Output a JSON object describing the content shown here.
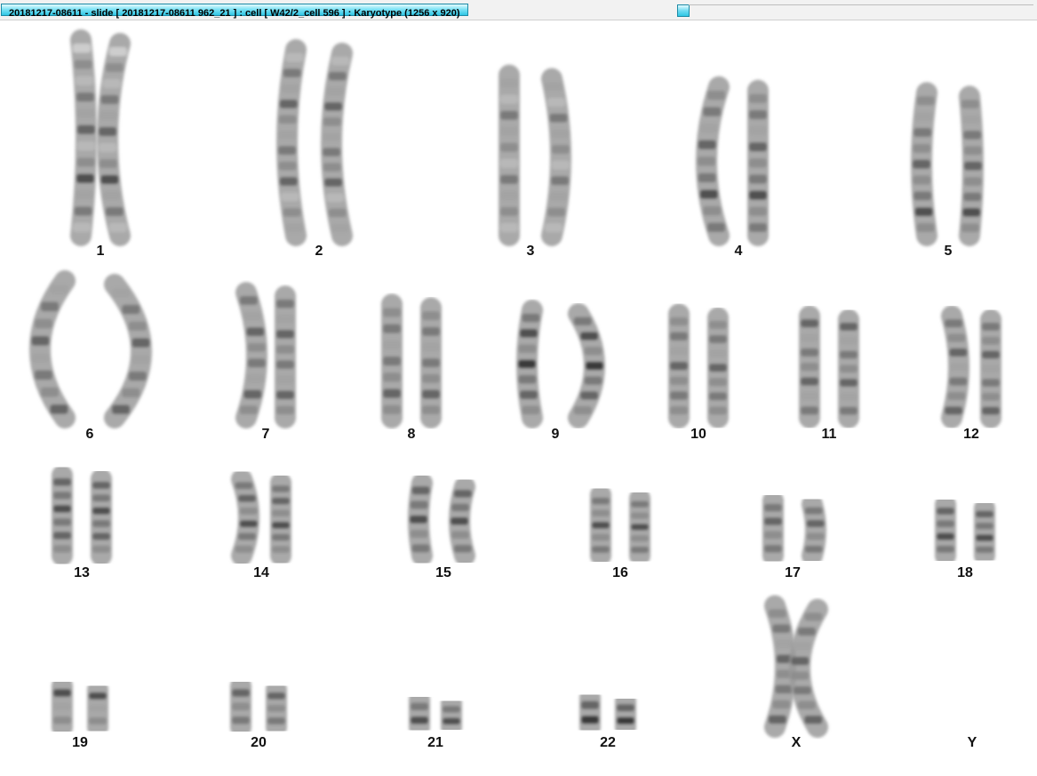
{
  "window": {
    "title": "20181217-08611 - slide [ 20181217-08611 962_21 ] : cell [ W42/2_cell 596 ] : Karyotype  (1256 x 920)"
  },
  "karyotype": {
    "chromosomes": [
      {
        "label": "1",
        "length": 1.0,
        "pattern": [
          0.2,
          0.5,
          0.3,
          0.6,
          0.4,
          0.7,
          0.3,
          0.5,
          0.8,
          0.4,
          0.6,
          0.3
        ]
      },
      {
        "label": "2",
        "length": 0.95,
        "pattern": [
          0.3,
          0.6,
          0.4,
          0.7,
          0.5,
          0.4,
          0.6,
          0.5,
          0.7,
          0.3,
          0.5,
          0.4
        ]
      },
      {
        "label": "3",
        "length": 0.82,
        "pattern": [
          0.4,
          0.3,
          0.6,
          0.4,
          0.5,
          0.3,
          0.6,
          0.4,
          0.5,
          0.3
        ]
      },
      {
        "label": "4",
        "length": 0.76,
        "pattern": [
          0.5,
          0.6,
          0.4,
          0.7,
          0.5,
          0.6,
          0.8,
          0.5,
          0.6
        ]
      },
      {
        "label": "5",
        "length": 0.73,
        "pattern": [
          0.5,
          0.4,
          0.6,
          0.5,
          0.7,
          0.5,
          0.6,
          0.8,
          0.5
        ]
      },
      {
        "label": "6",
        "length": 0.7,
        "pattern": [
          0.4,
          0.6,
          0.5,
          0.7,
          0.4,
          0.6,
          0.5,
          0.7
        ]
      },
      {
        "label": "7",
        "length": 0.64,
        "pattern": [
          0.6,
          0.4,
          0.7,
          0.5,
          0.6,
          0.4,
          0.7,
          0.5
        ]
      },
      {
        "label": "8",
        "length": 0.58,
        "pattern": [
          0.5,
          0.6,
          0.4,
          0.6,
          0.5,
          0.7,
          0.5
        ]
      },
      {
        "label": "9",
        "length": 0.55,
        "pattern": [
          0.6,
          0.8,
          0.5,
          0.9,
          0.6,
          0.7,
          0.5
        ]
      },
      {
        "label": "10",
        "length": 0.53,
        "pattern": [
          0.5,
          0.6,
          0.4,
          0.7,
          0.5,
          0.6,
          0.5
        ]
      },
      {
        "label": "11",
        "length": 0.52,
        "pattern": [
          0.7,
          0.4,
          0.6,
          0.5,
          0.7,
          0.4,
          0.6
        ]
      },
      {
        "label": "12",
        "length": 0.52,
        "pattern": [
          0.6,
          0.5,
          0.7,
          0.4,
          0.6,
          0.5,
          0.7
        ]
      },
      {
        "label": "13",
        "length": 0.41,
        "pattern": [
          0.7,
          0.6,
          0.8,
          0.6,
          0.7,
          0.5
        ]
      },
      {
        "label": "14",
        "length": 0.39,
        "pattern": [
          0.6,
          0.7,
          0.5,
          0.8,
          0.6,
          0.5
        ]
      },
      {
        "label": "15",
        "length": 0.37,
        "pattern": [
          0.7,
          0.6,
          0.8,
          0.5,
          0.6
        ]
      },
      {
        "label": "16",
        "length": 0.31,
        "pattern": [
          0.6,
          0.5,
          0.8,
          0.5,
          0.6
        ]
      },
      {
        "label": "17",
        "length": 0.28,
        "pattern": [
          0.6,
          0.7,
          0.5,
          0.6
        ]
      },
      {
        "label": "18",
        "length": 0.26,
        "pattern": [
          0.7,
          0.6,
          0.8,
          0.6
        ]
      },
      {
        "label": "19",
        "length": 0.21,
        "pattern": [
          0.8,
          0.4,
          0.5
        ]
      },
      {
        "label": "20",
        "length": 0.21,
        "pattern": [
          0.7,
          0.5,
          0.6
        ]
      },
      {
        "label": "21",
        "length": 0.14,
        "pattern": [
          0.6,
          0.8
        ]
      },
      {
        "label": "22",
        "length": 0.15,
        "pattern": [
          0.7,
          0.9
        ]
      },
      {
        "label": "X",
        "length": 0.62,
        "pattern": [
          0.5,
          0.6,
          0.4,
          0.7,
          0.5,
          0.6,
          0.5,
          0.7
        ]
      },
      {
        "label": "Y",
        "length": 0,
        "pattern": []
      }
    ]
  }
}
